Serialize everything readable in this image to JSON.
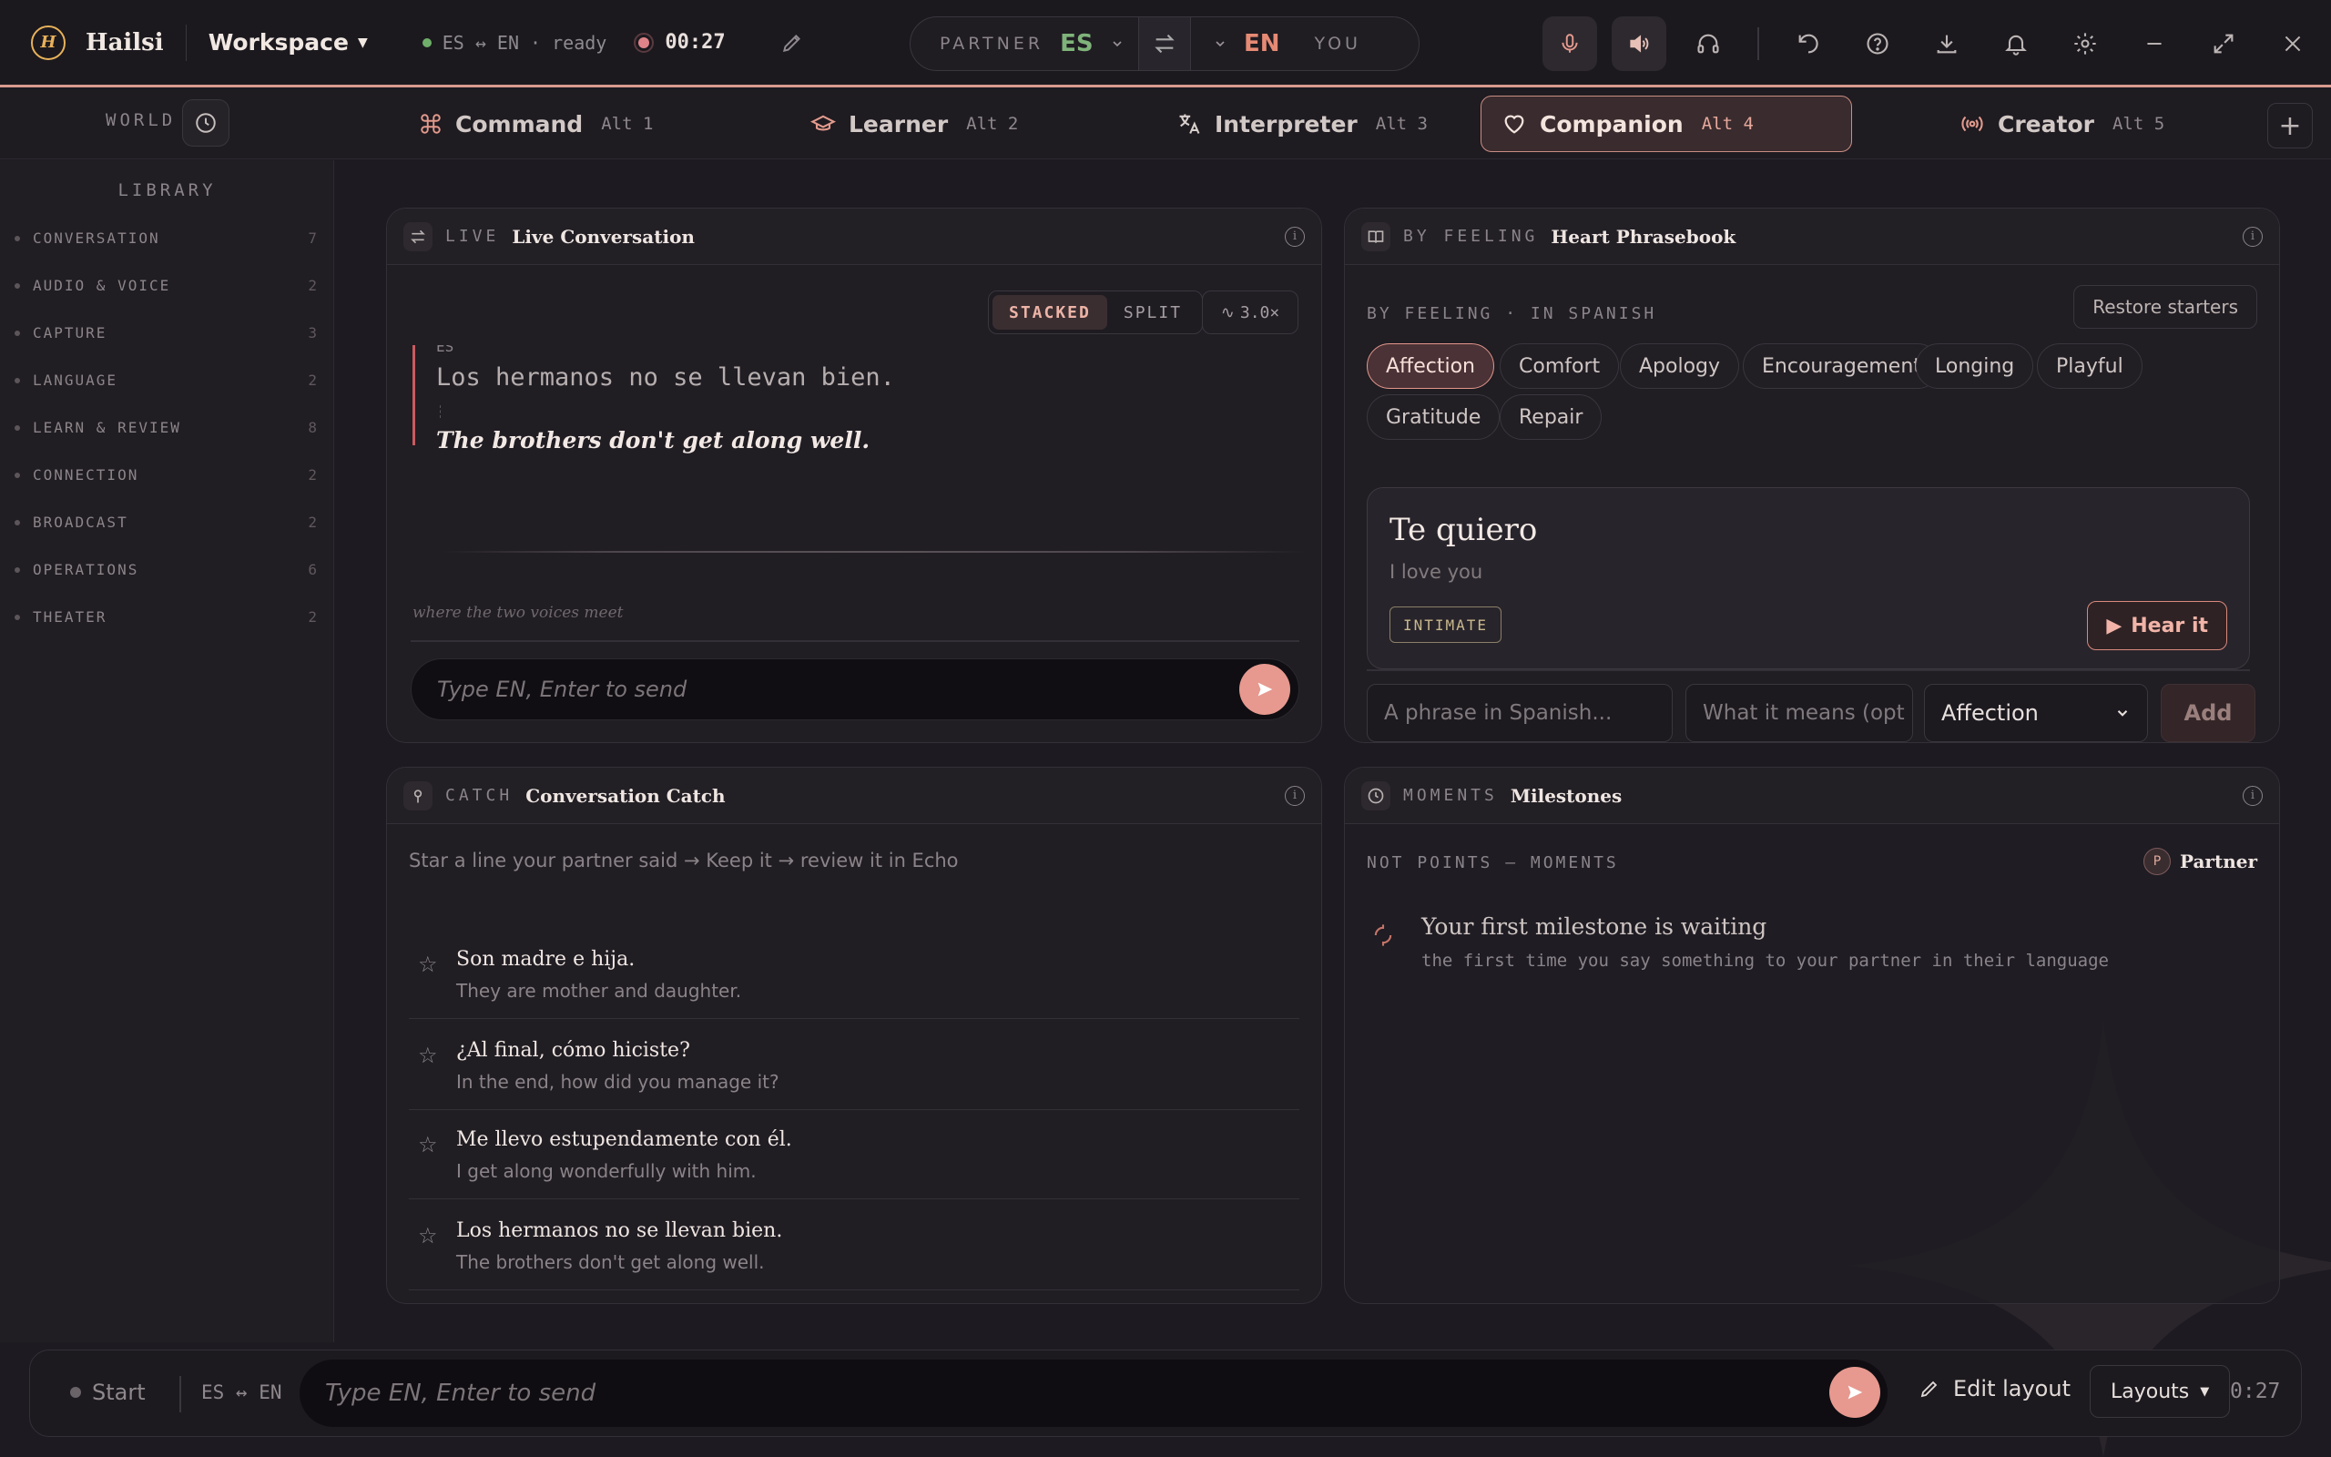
{
  "app": {
    "name": "Hailsi",
    "logo_glyph": "H",
    "workspace_label": "Workspace",
    "status_pair": "ES ↔ EN · ready",
    "timer": "00:27"
  },
  "language_pill": {
    "partner_label": "PARTNER",
    "partner_lang": "ES",
    "you_lang": "EN",
    "you_label": "YOU"
  },
  "toolbar_icons": [
    "microphone-icon",
    "speaker-icon",
    "headphones-icon",
    "undo-icon",
    "help-icon",
    "download-icon",
    "bell-icon",
    "gear-icon",
    "minimize-icon",
    "expand-icon",
    "close-icon"
  ],
  "world": {
    "label": "WORLD"
  },
  "tabs": [
    {
      "label": "Command",
      "hotkey": "Alt 1",
      "icon": "command-icon"
    },
    {
      "label": "Learner",
      "hotkey": "Alt 2",
      "icon": "graduation-cap-icon"
    },
    {
      "label": "Interpreter",
      "hotkey": "Alt 3",
      "icon": "translate-icon"
    },
    {
      "label": "Companion",
      "hotkey": "Alt 4",
      "icon": "heart-icon",
      "active": true
    },
    {
      "label": "Creator",
      "hotkey": "Alt 5",
      "icon": "broadcast-icon"
    }
  ],
  "library": {
    "title": "LIBRARY",
    "items": [
      {
        "label": "CONVERSATION",
        "count": "7"
      },
      {
        "label": "AUDIO & VOICE",
        "count": "2"
      },
      {
        "label": "CAPTURE",
        "count": "3"
      },
      {
        "label": "LANGUAGE",
        "count": "2"
      },
      {
        "label": "LEARN & REVIEW",
        "count": "8"
      },
      {
        "label": "CONNECTION",
        "count": "2"
      },
      {
        "label": "BROADCAST",
        "count": "2"
      },
      {
        "label": "OPERATIONS",
        "count": "6"
      },
      {
        "label": "THEATER",
        "count": "2"
      }
    ]
  },
  "live_conversation": {
    "tag": "LIVE",
    "title": "Live Conversation",
    "mode_stacked": "STACKED",
    "mode_split": "SPLIT",
    "speed": "3.0×",
    "source_lang": "ES",
    "source_text": "Los hermanos no se llevan bien.",
    "translation": "The brothers don't get along well.",
    "footer_note": "where the two voices meet",
    "input_placeholder": "Type EN, Enter to send"
  },
  "heart_phrasebook": {
    "tag": "BY FEELING",
    "title": "Heart Phrasebook",
    "subtitle": "BY FEELING · IN SPANISH",
    "restore_label": "Restore starters",
    "chips": [
      "Affection",
      "Comfort",
      "Apology",
      "Encouragement",
      "Longing",
      "Playful",
      "Gratitude",
      "Repair"
    ],
    "active_chip": "Affection",
    "card": {
      "phrase": "Te quiero",
      "meaning": "I love you",
      "tag": "INTIMATE",
      "hear_label": "Hear it"
    },
    "phrase_placeholder": "A phrase in Spanish...",
    "meaning_placeholder": "What it means (opt",
    "select_value": "Affection",
    "add_label": "Add"
  },
  "conversation_catch": {
    "tag": "CATCH",
    "title": "Conversation Catch",
    "hint": "Star a line your partner said → Keep it → review it in Echo",
    "items": [
      {
        "es": "Son madre e hija.",
        "en": "They are mother and daughter."
      },
      {
        "es": "¿Al final, cómo hiciste?",
        "en": "In the end, how did you manage it?"
      },
      {
        "es": "Me llevo estupendamente con él.",
        "en": "I get along wonderfully with him."
      },
      {
        "es": "Los hermanos no se llevan bien.",
        "en": "The brothers don't get along well."
      }
    ]
  },
  "milestones": {
    "tag": "MOMENTS",
    "title": "Milestones",
    "subtitle": "NOT POINTS — MOMENTS",
    "partner_initial": "P",
    "partner_label": "Partner",
    "empty_title": "Your first milestone is waiting",
    "empty_desc": "the first time you say something to your partner in their language"
  },
  "footer": {
    "start_label": "Start",
    "lang_pair": "ES ↔ EN",
    "input_placeholder": "Type EN, Enter to send",
    "edit_layout": "Edit layout",
    "layouts": "Layouts",
    "elapsed": "0:27"
  },
  "colors": {
    "accent": "#e7998f",
    "bg": "#1d1a21",
    "panel": "#201d23",
    "partner_lang": "#7fb37a",
    "you_lang": "#e68a74"
  }
}
